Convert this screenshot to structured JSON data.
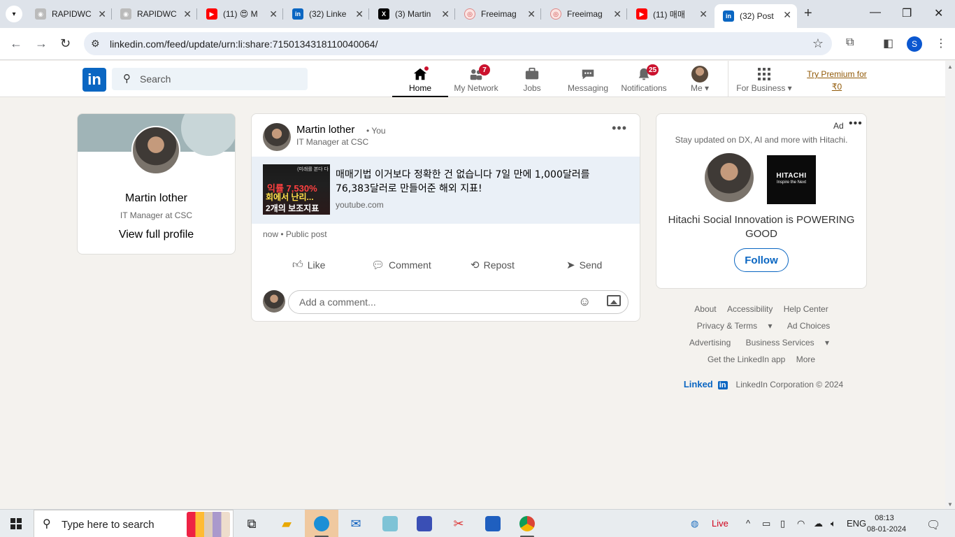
{
  "browser": {
    "tabs": [
      {
        "title": "RAPIDWC",
        "favicon": "rapid",
        "active": false
      },
      {
        "title": "RAPIDWC",
        "favicon": "rapid",
        "active": false
      },
      {
        "title": "(11) 😍 M",
        "favicon": "youtube",
        "active": false
      },
      {
        "title": "(32) Linke",
        "favicon": "linkedin",
        "active": false
      },
      {
        "title": "(3) Martin",
        "favicon": "x",
        "active": false
      },
      {
        "title": "Freeimag",
        "favicon": "freeimages",
        "active": false
      },
      {
        "title": "Freeimag",
        "favicon": "freeimages",
        "active": false
      },
      {
        "title": "(11) 매매",
        "favicon": "youtube",
        "active": false
      },
      {
        "title": "(32) Post",
        "favicon": "linkedin",
        "active": true
      }
    ],
    "url": "linkedin.com/feed/update/urn:li:share:7150134318110040064/",
    "profile_initial": "S"
  },
  "linkedin": {
    "search_placeholder": "Search",
    "nav": [
      {
        "label": "Home",
        "icon": "home-icon",
        "badge": "",
        "active": true
      },
      {
        "label": "My Network",
        "icon": "network-icon",
        "badge": "7",
        "active": false
      },
      {
        "label": "Jobs",
        "icon": "briefcase-icon",
        "badge": "",
        "active": false
      },
      {
        "label": "Messaging",
        "icon": "messaging-icon",
        "badge": "",
        "active": false
      },
      {
        "label": "Notifications",
        "icon": "bell-icon",
        "badge": "25",
        "active": false
      },
      {
        "label": "Me",
        "icon": "avatar",
        "badge": "",
        "active": false
      },
      {
        "label": "For Business",
        "icon": "grid-icon",
        "badge": "",
        "active": false
      }
    ],
    "premium_line1": "Try Premium for",
    "premium_line2": "₹0"
  },
  "profile_card": {
    "name": "Martin lother",
    "title": "IT Manager at CSC",
    "view_profile": "View full profile"
  },
  "post": {
    "author": "Martin lother",
    "you_label": "• You",
    "author_title": "IT Manager at CSC",
    "thumb_top": "(미래를 본다 다",
    "thumb_line1": "익률 7,530%",
    "thumb_line2": "회에서 난리...",
    "thumb_line3": "2개의 보조지표",
    "headline": "매매기법 이거보다 정확한 건 없습니다 7일 만에 1,000달러를 76,383달러로 만들어준 해외 지표!",
    "domain": "youtube.com",
    "meta": "now • Public post",
    "actions": {
      "like": "Like",
      "comment": "Comment",
      "repost": "Repost",
      "send": "Send"
    },
    "comment_placeholder": "Add a comment..."
  },
  "ad": {
    "label": "Ad",
    "subtitle": "Stay updated on DX, AI and more with Hitachi.",
    "brand_name": "HITACHI",
    "brand_tagline": "Inspire the Next",
    "headline": "Hitachi Social Innovation is POWERING GOOD",
    "follow": "Follow"
  },
  "footer": {
    "row1": [
      "About",
      "Accessibility",
      "Help Center"
    ],
    "row2": [
      "Privacy & Terms",
      "Ad Choices"
    ],
    "row3": [
      "Advertising",
      "Business Services"
    ],
    "row4": [
      "Get the LinkedIn app",
      "More"
    ],
    "brand": "Linked",
    "brand_in": "in",
    "copyright": "LinkedIn Corporation © 2024"
  },
  "taskbar": {
    "search_placeholder": "Type here to search",
    "weather": "Live",
    "language": "ENG",
    "time": "08:13",
    "date": "08-01-2024"
  },
  "colors": {
    "linkedin_blue": "#0a66c2",
    "badge_red": "#cb112d",
    "premium_gold": "#915907",
    "page_bg": "#f4f2ee"
  }
}
